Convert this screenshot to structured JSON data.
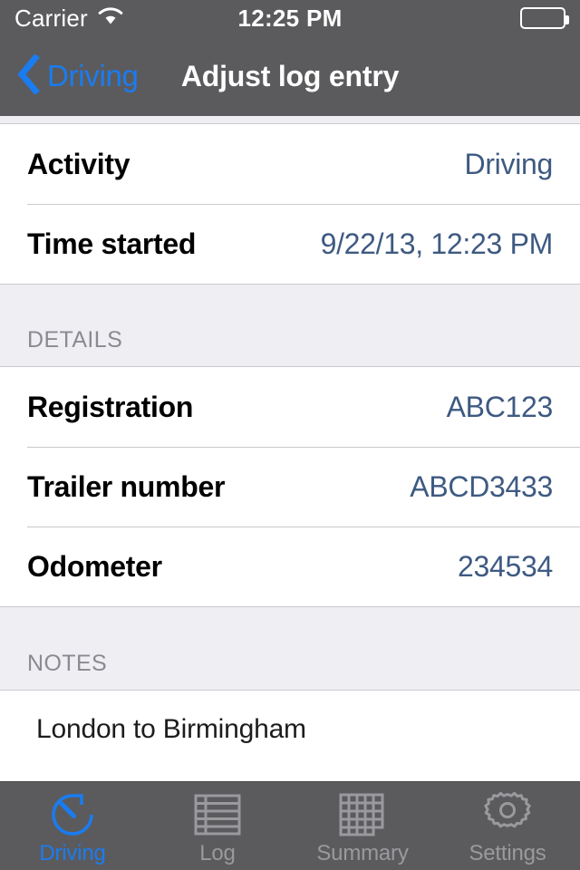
{
  "status_bar": {
    "carrier": "Carrier",
    "wifi_icon": "wifi-icon",
    "time": "12:25 PM",
    "battery_icon": "battery-icon"
  },
  "nav_bar": {
    "back_icon": "chevron-left-icon",
    "back_label": "Driving",
    "title": "Adjust log entry"
  },
  "colors": {
    "accent_blue": "#1a7cf0",
    "value_blue": "#3e5a82",
    "bar_gray": "#5b5b5d",
    "group_bg": "#eeeef3",
    "separator": "#c9c9ce",
    "inactive_tab": "#9a9a9e"
  },
  "sections": [
    {
      "header": null,
      "rows": [
        {
          "label": "Activity",
          "value": "Driving"
        },
        {
          "label": "Time started",
          "value": "9/22/13, 12:23 PM"
        }
      ]
    },
    {
      "header": "DETAILS",
      "rows": [
        {
          "label": "Registration",
          "value": "ABC123"
        },
        {
          "label": "Trailer number",
          "value": "ABCD3433"
        },
        {
          "label": "Odometer",
          "value": "234534"
        }
      ]
    },
    {
      "header": "NOTES",
      "notes_value": "London to Birmingham"
    }
  ],
  "tab_bar": {
    "items": [
      {
        "label": "Driving",
        "icon": "stopwatch-icon",
        "active": true
      },
      {
        "label": "Log",
        "icon": "table-icon",
        "active": false
      },
      {
        "label": "Summary",
        "icon": "grid-icon",
        "active": false
      },
      {
        "label": "Settings",
        "icon": "gear-icon",
        "active": false
      }
    ]
  }
}
